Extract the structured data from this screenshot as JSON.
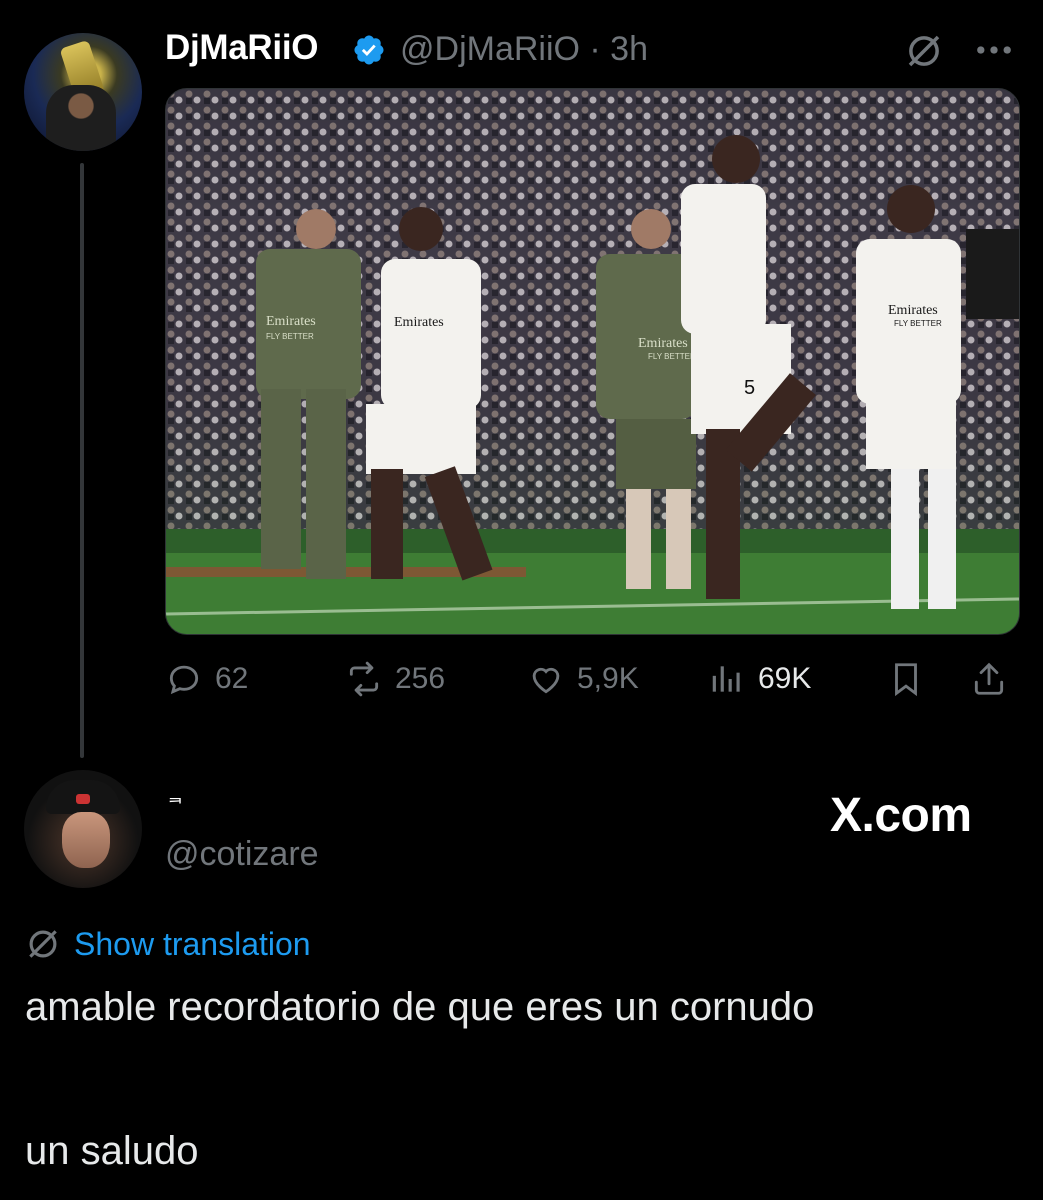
{
  "tweet": {
    "author_name": "DjMaRiiO",
    "handle_time": "@DjMaRiiO · 3h",
    "media_alt": "Players celebrating on the pitch",
    "media_texts": {
      "sponsor_a": "Emirates",
      "sponsor_a_sub": "FLY BETTER",
      "sponsor_b": "Emirates",
      "sponsor_c": "Emirates",
      "sponsor_c_sub": "FLY BETTER",
      "sponsor_d": "Emirates",
      "sponsor_d_sub": "FLY BETTER",
      "shirt_number": "5"
    },
    "actions": {
      "replies": "62",
      "reposts": "256",
      "likes": "5,9K",
      "views": "69K"
    }
  },
  "reply": {
    "author_name": "ᆿ",
    "handle": "@cotizare",
    "watermark": "X.com",
    "translation_link": "Show translation",
    "text": "amable recordatorio de que eres un cornudo\n\n\nun saludo"
  },
  "icons": {
    "verified": "verified-badge-icon",
    "grok": "grok-icon",
    "more": "more-icon",
    "reply": "reply-icon",
    "repost": "repost-icon",
    "like": "heart-icon",
    "views": "views-icon",
    "bookmark": "bookmark-icon",
    "share": "share-icon",
    "translate": "translate-icon"
  },
  "colors": {
    "background": "#000000",
    "text": "#e7e9ea",
    "muted": "#71767b",
    "accent": "#1d9bf0",
    "thread_line": "#333639"
  }
}
